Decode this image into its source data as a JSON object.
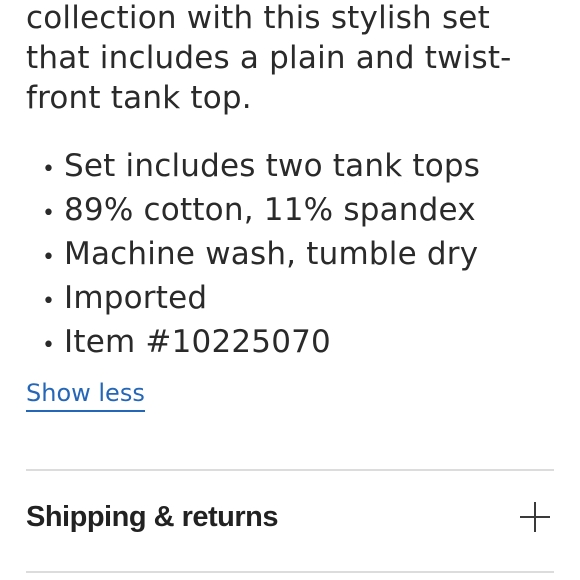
{
  "description": {
    "lines": [
      "collection with this stylish set",
      "that includes a plain and twist-",
      "front tank top."
    ]
  },
  "details": [
    "Set includes two tank tops",
    "89% cotton, 11% spandex",
    "Machine wash, tumble dry",
    "Imported",
    "Item #10225070"
  ],
  "bullet_char": "•",
  "toggle": {
    "label": "Show less"
  },
  "accordion": {
    "title": "Shipping & returns",
    "icon": "plus-icon"
  }
}
